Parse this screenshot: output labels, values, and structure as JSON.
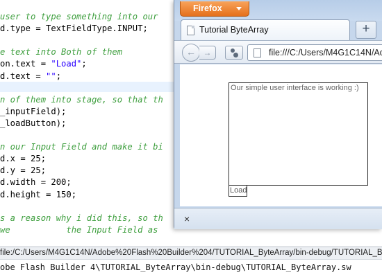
{
  "editor": {
    "lines": [
      {
        "text": "user to type something into our",
        "kind": "comment"
      },
      {
        "text": "d.type = TextFieldType.INPUT;",
        "kind": "code"
      },
      {
        "text": "",
        "kind": "code"
      },
      {
        "text": "e text into Both of them",
        "kind": "comment"
      },
      {
        "text": "on.text = ",
        "kind": "code",
        "str": "\"Load\"",
        "tail": ";"
      },
      {
        "text": "d.text = ",
        "kind": "code",
        "str": "\"\"",
        "tail": ";"
      },
      {
        "text": "",
        "kind": "code"
      },
      {
        "text": "n of them into stage, so that th",
        "kind": "comment"
      },
      {
        "text": "_inputField);",
        "kind": "code"
      },
      {
        "text": "_loadButton);",
        "kind": "code"
      },
      {
        "text": "",
        "kind": "code"
      },
      {
        "text": "n our Input Field and make it bi",
        "kind": "comment"
      },
      {
        "text": "d.x = 25;",
        "kind": "code"
      },
      {
        "text": "d.y = 25;",
        "kind": "code"
      },
      {
        "text": "d.width = 200;",
        "kind": "code"
      },
      {
        "text": "d.height = 150;",
        "kind": "code"
      },
      {
        "text": "",
        "kind": "code"
      },
      {
        "text": "s a reason why i did this, so th",
        "kind": "comment"
      },
      {
        "text": "we           the Input Field as",
        "kind": "comment"
      }
    ],
    "status_path": "file:/C:/Users/M4G1C14N/Adobe%20Flash%20Builder%204/TUTORIAL_ByteArray/bin-debug/TUTORIAL_ByteArray",
    "console_path": "obe Flash Builder 4\\TUTORIAL_ByteArray\\bin-debug\\TUTORIAL_ByteArray.sw"
  },
  "browser": {
    "menu_label": "Firefox",
    "tab_title": "Tutorial ByteArray",
    "new_tab_label": "+",
    "url": "file:///C:/Users/M4G1C14N/Ad",
    "close_find_label": "×"
  },
  "swf": {
    "input_text": "Our simple user interface is working :)",
    "load_button_label": "Load"
  }
}
